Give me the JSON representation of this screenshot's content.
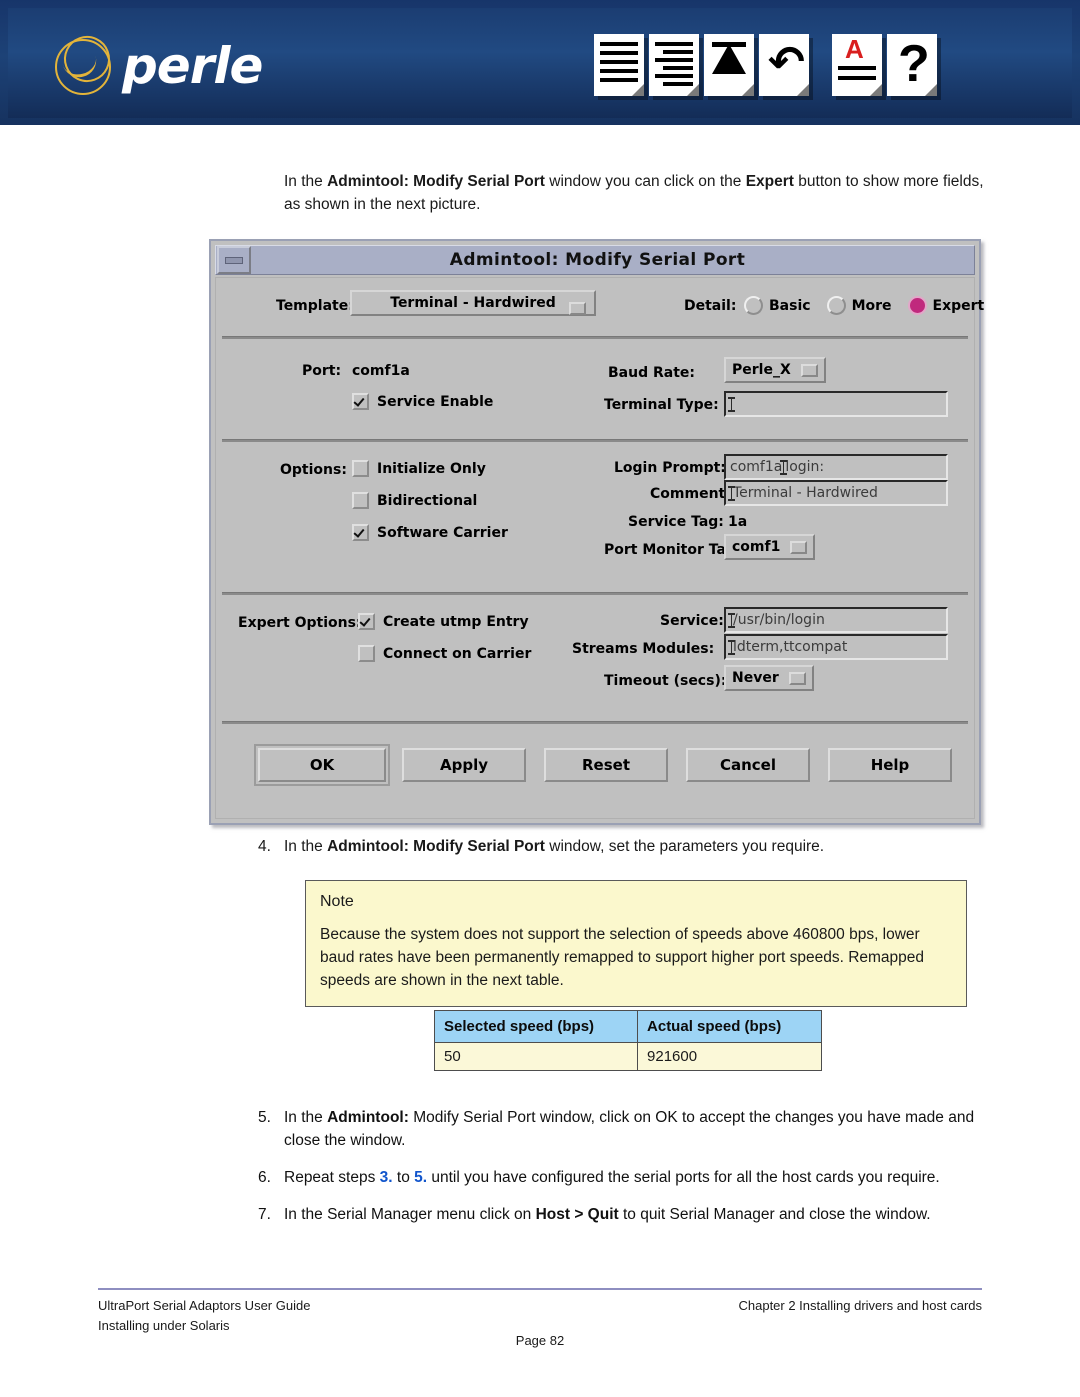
{
  "header": {
    "brand": "perle",
    "icons": [
      "list-document-icon",
      "indented-list-document-icon",
      "funnel-document-icon",
      "undo-document-icon",
      "spellcheck-document-icon",
      "help-document-icon"
    ]
  },
  "intro": {
    "line1_a": "In the ",
    "line1_b": "Admintool: Modify Serial Port",
    "line1_c": " window you can click on the ",
    "line1_d": "Expert",
    "line1_e": " button to show more fields, as shown in the next picture."
  },
  "dialog": {
    "title": "Admintool: Modify Serial Port",
    "template": {
      "label": "Template:",
      "value": "Terminal - Hardwired"
    },
    "detail": {
      "label": "Detail:",
      "options": [
        "Basic",
        "More",
        "Expert"
      ],
      "selected": "Expert"
    },
    "port": {
      "label": "Port:",
      "value": "comf1a",
      "service_enable": {
        "label": "Service Enable",
        "checked": true
      },
      "baud_rate": {
        "label": "Baud Rate:",
        "value": "Perle_X"
      },
      "terminal_type": {
        "label": "Terminal Type:",
        "value": ""
      }
    },
    "options": {
      "label": "Options:",
      "checks": [
        {
          "label": "Initialize Only",
          "checked": false
        },
        {
          "label": "Bidirectional",
          "checked": false
        },
        {
          "label": "Software Carrier",
          "checked": true
        }
      ],
      "login_prompt": {
        "label": "Login Prompt:",
        "value_before": "comf1a ",
        "value_after": "login:"
      },
      "comment": {
        "label": "Comment:",
        "value": "Terminal - Hardwired"
      },
      "service_tag": {
        "label": "Service Tag:",
        "value": "1a"
      },
      "port_monitor_tag": {
        "label": "Port Monitor Tag:",
        "value": "comf1"
      }
    },
    "expert": {
      "label": "Expert Options:",
      "checks": [
        {
          "label": "Create utmp Entry",
          "checked": true
        },
        {
          "label": "Connect on Carrier",
          "checked": false
        }
      ],
      "service": {
        "label": "Service:",
        "value": "/usr/bin/login"
      },
      "streams_modules": {
        "label": "Streams Modules:",
        "value": "ldterm,ttcompat"
      },
      "timeout": {
        "label": "Timeout (secs):",
        "value": "Never"
      }
    },
    "buttons": [
      "OK",
      "Apply",
      "Reset",
      "Cancel",
      "Help"
    ]
  },
  "step4": {
    "num": "4.",
    "a": "In the ",
    "b": "Admintool: Modify Serial Port",
    "c": " window, set the parameters you require."
  },
  "note": {
    "title": "Note",
    "body": "Because the system does not support the selection of speeds above 460800 bps, lower baud rates have been permanently remapped to support higher port speeds. Remapped speeds are shown in the next table."
  },
  "speed_table": {
    "headers": [
      "Selected speed (bps)",
      "Actual speed (bps)"
    ],
    "rows": [
      [
        "50",
        "921600"
      ]
    ]
  },
  "steps": [
    {
      "num": "5.",
      "a": "In the ",
      "b": "Admintool:",
      "c": " Modify Serial Port window, click on OK to accept the changes you have made and close the window."
    },
    {
      "num": "6.",
      "a": "Repeat steps ",
      "ref1": "3.",
      "mid": " to ",
      "ref2": "5.",
      "c": " until you have configured the serial ports for all the host cards  you require."
    },
    {
      "num": "7.",
      "a": "In the Serial Manager menu click on ",
      "b": "Host > Quit",
      "c": " to quit Serial Manager and close the window."
    }
  ],
  "footer": {
    "left_line1": "UltraPort Serial Adaptors User Guide",
    "left_line2": "Installing under Solaris",
    "right": "Chapter 2 Installing drivers and host cards",
    "center": "Page 82"
  },
  "colors": {
    "banner": "#1d4277",
    "logo_gold": "#e3b43a",
    "radio_selected": "#c0297d",
    "note_bg": "#fbf8cd",
    "table_header_bg": "#9dd4f5",
    "table_cell_bg": "#fbf8d8",
    "link_blue": "#1155cc",
    "footer_rule": "#8e8ec0"
  }
}
